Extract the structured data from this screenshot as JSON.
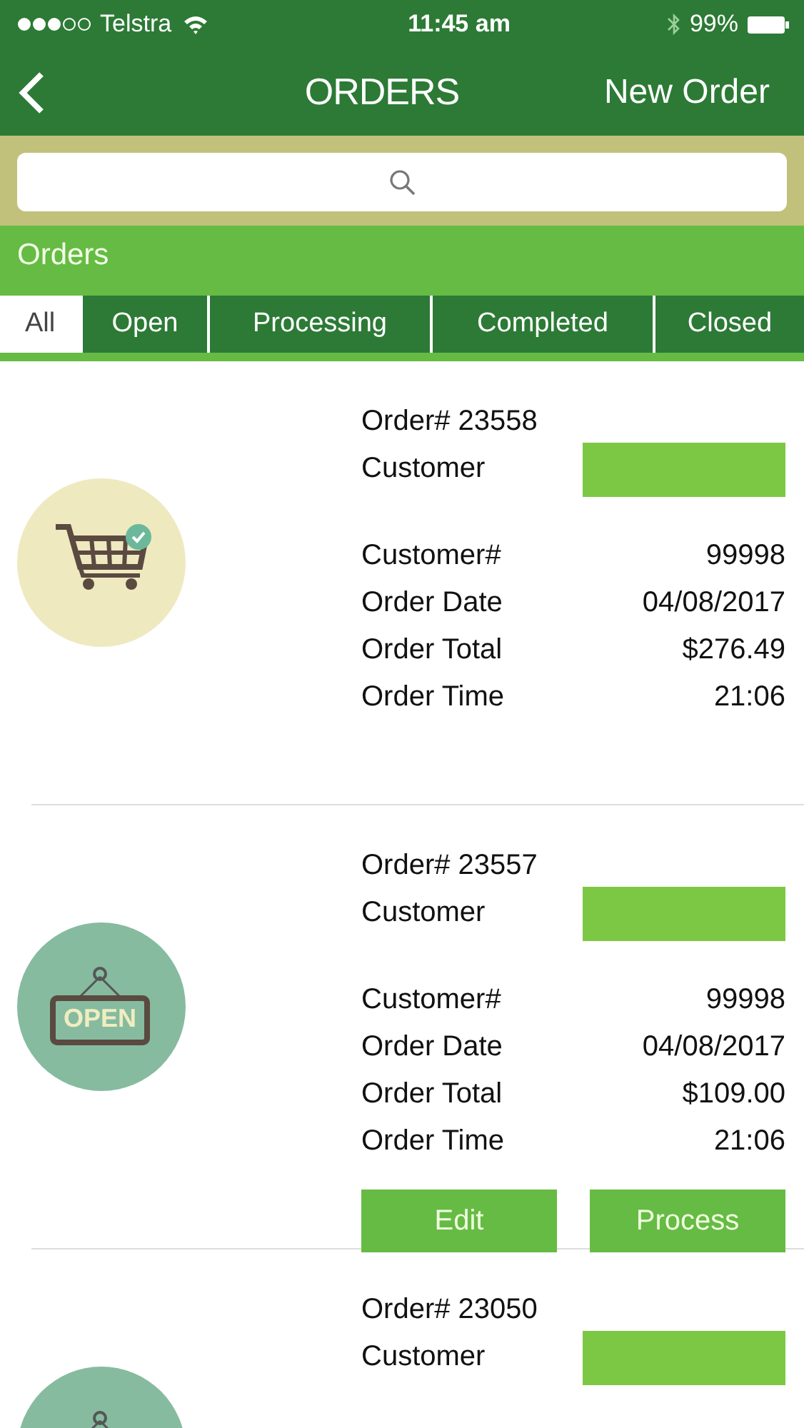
{
  "status_bar": {
    "carrier": "Telstra",
    "time": "11:45 am",
    "battery": "99%"
  },
  "nav_bar": {
    "title": "ORDERS",
    "action": "New Order"
  },
  "section_header": "Orders",
  "tabs": [
    {
      "label": "All",
      "selected": true
    },
    {
      "label": "Open",
      "selected": false
    },
    {
      "label": "Processing",
      "selected": false
    },
    {
      "label": "Completed",
      "selected": false
    },
    {
      "label": "Closed",
      "selected": false
    }
  ],
  "orders": [
    {
      "order_number": "Order# 23558",
      "customer_label": "Customer",
      "customer_redacted": true,
      "status_icon": {
        "kind": "cart"
      },
      "fields": [
        {
          "label": "Customer#",
          "value": "99998"
        },
        {
          "label": "Order Date",
          "value": "04/08/2017"
        },
        {
          "label": "Order Total",
          "value": "$276.49"
        },
        {
          "label": "Order Time",
          "value": "21:06"
        }
      ]
    },
    {
      "order_number": "Order# 23557",
      "customer_label": "Customer",
      "customer_redacted": true,
      "status_icon": {
        "kind": "open_sign",
        "label": "OPEN"
      },
      "fields": [
        {
          "label": "Customer#",
          "value": "99998"
        },
        {
          "label": "Order Date",
          "value": "04/08/2017"
        },
        {
          "label": "Order Total",
          "value": "$109.00"
        },
        {
          "label": "Order Time",
          "value": "21:06"
        }
      ],
      "actions": [
        "Edit",
        "Process"
      ]
    },
    {
      "order_number": "Order# 23050",
      "customer_label": "Customer",
      "customer_redacted": true,
      "status_icon": {
        "kind": "open_sign"
      }
    }
  ]
}
